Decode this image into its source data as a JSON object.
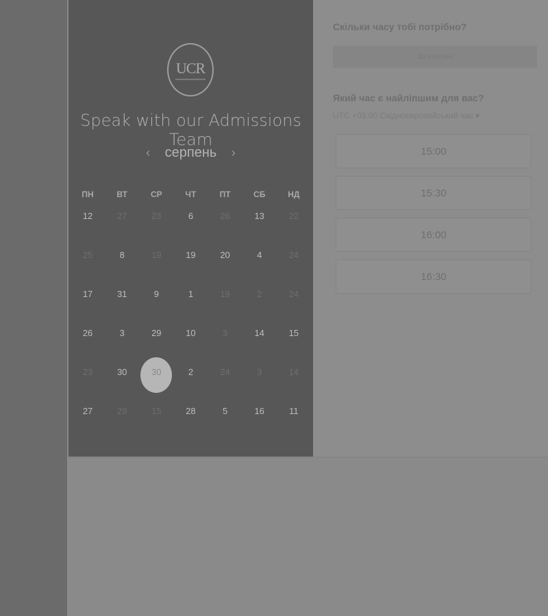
{
  "panel": {
    "logo_text": "UCR",
    "title": "Speak with our Admissions Team",
    "month": "серпень",
    "prev_arrow": "‹",
    "next_arrow": "›"
  },
  "calendar": {
    "weekdays": [
      "ПН",
      "ВТ",
      "СР",
      "ЧТ",
      "ПТ",
      "СБ",
      "НД"
    ],
    "weeks": [
      [
        {
          "d": "12",
          "dim": false
        },
        {
          "d": "27",
          "dim": true
        },
        {
          "d": "23",
          "dim": true
        },
        {
          "d": "6",
          "dim": false
        },
        {
          "d": "26",
          "dim": true
        },
        {
          "d": "13",
          "dim": false
        },
        {
          "d": "22",
          "dim": true
        }
      ],
      [
        {
          "d": "25",
          "dim": true
        },
        {
          "d": "8",
          "dim": false
        },
        {
          "d": "19",
          "dim": true
        },
        {
          "d": "19",
          "dim": false
        },
        {
          "d": "20",
          "dim": false
        },
        {
          "d": "4",
          "dim": false
        },
        {
          "d": "24",
          "dim": true
        }
      ],
      [
        {
          "d": "17",
          "dim": false
        },
        {
          "d": "31",
          "dim": false
        },
        {
          "d": "9",
          "dim": false
        },
        {
          "d": "1",
          "dim": false
        },
        {
          "d": "19",
          "dim": true
        },
        {
          "d": "2",
          "dim": true
        },
        {
          "d": "24",
          "dim": true
        }
      ],
      [
        {
          "d": "26",
          "dim": false
        },
        {
          "d": "3",
          "dim": false
        },
        {
          "d": "29",
          "dim": false
        },
        {
          "d": "10",
          "dim": false
        },
        {
          "d": "3",
          "dim": true
        },
        {
          "d": "14",
          "dim": false
        },
        {
          "d": "15",
          "dim": false
        }
      ],
      [
        {
          "d": "23",
          "dim": true
        },
        {
          "d": "30",
          "dim": false
        },
        {
          "d": "30",
          "dim": false,
          "selected": true
        },
        {
          "d": "2",
          "dim": false
        },
        {
          "d": "24",
          "dim": true
        },
        {
          "d": "3",
          "dim": true
        },
        {
          "d": "14",
          "dim": true
        }
      ],
      [
        {
          "d": "27",
          "dim": false
        },
        {
          "d": "29",
          "dim": true
        },
        {
          "d": "15",
          "dim": true
        },
        {
          "d": "28",
          "dim": false
        },
        {
          "d": "5",
          "dim": false
        },
        {
          "d": "16",
          "dim": false
        },
        {
          "d": "11",
          "dim": false
        }
      ]
    ]
  },
  "booking": {
    "duration_question": "Скільки часу тобі потрібно?",
    "duration_value": "30 хвилин",
    "time_question": "Який час є найліпшим для вас?",
    "timezone": "UTC +03:00 Східноєвропейський час ▾",
    "slots": [
      "15:00",
      "15:30",
      "16:00",
      "16:30"
    ]
  }
}
